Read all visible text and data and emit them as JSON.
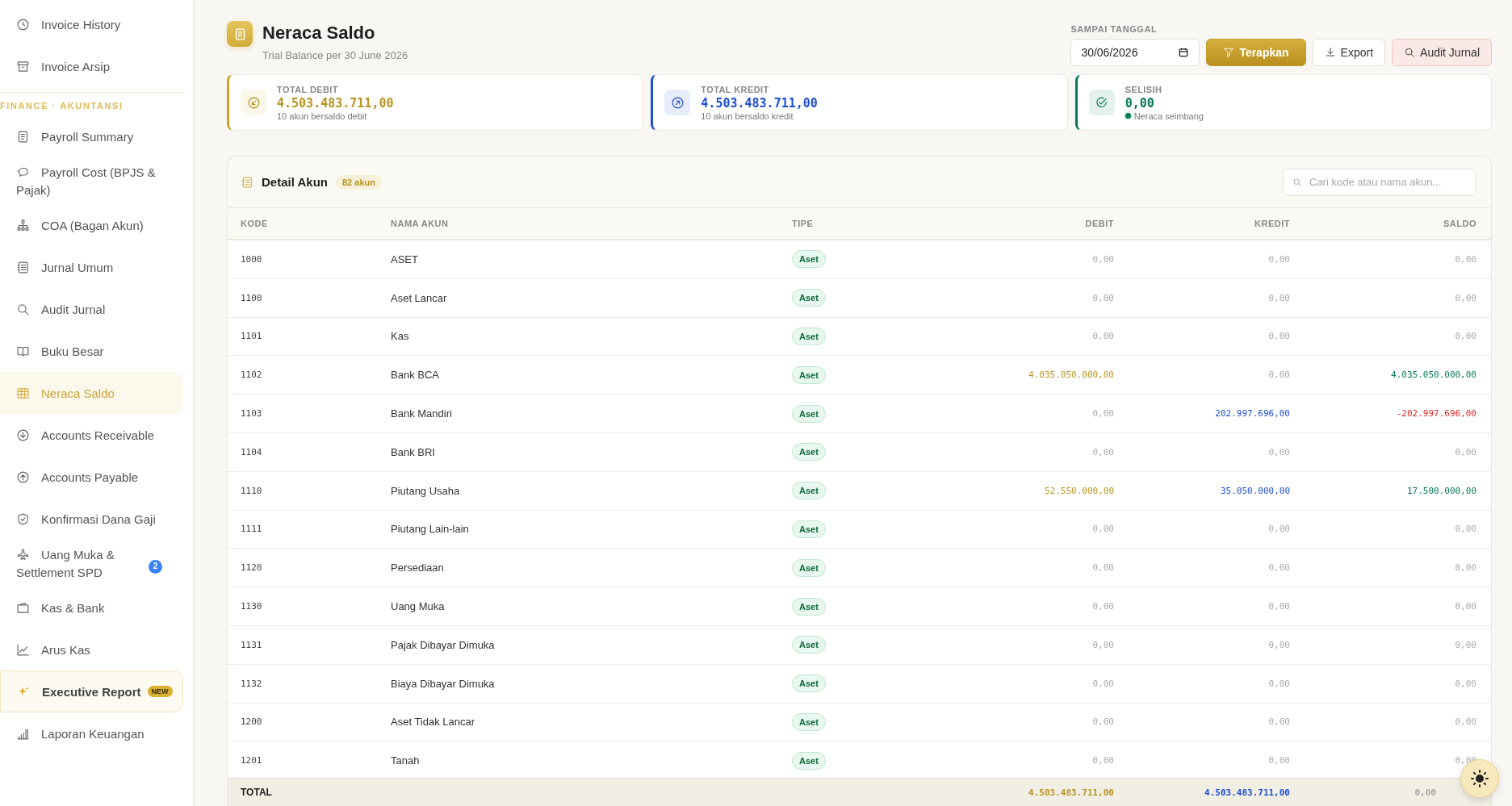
{
  "sidebar": {
    "items": [
      {
        "label": "Invoice History",
        "selected": false
      },
      {
        "label": "Invoice Arsip",
        "selected": false
      },
      {
        "kind": "section",
        "label": "FINANCE · AKUNTANSI"
      },
      {
        "label": "Payroll Summary",
        "selected": false
      },
      {
        "label": "Payroll Cost (BPJS & Pajak)",
        "selected": false
      },
      {
        "label": "COA (Bagan Akun)",
        "selected": false
      },
      {
        "label": "Jurnal Umum",
        "selected": false
      },
      {
        "label": "Audit Jurnal",
        "selected": false
      },
      {
        "label": "Buku Besar",
        "selected": false
      },
      {
        "label": "Neraca Saldo",
        "selected": true
      },
      {
        "label": "Accounts Receivable",
        "selected": false
      },
      {
        "label": "Accounts Payable",
        "selected": false
      },
      {
        "label": "Konfirmasi Dana Gaji",
        "selected": false
      },
      {
        "label": "Uang Muka & Settlement SPD",
        "selected": false,
        "badge": "2"
      },
      {
        "label": "Kas & Bank",
        "selected": false
      },
      {
        "label": "Arus Kas",
        "selected": false
      },
      {
        "kind": "featured",
        "label": "Executive Report",
        "selected": false,
        "badge": "NEW"
      },
      {
        "label": "Laporan Keuangan",
        "selected": false
      }
    ]
  },
  "header": {
    "title": "Neraca Saldo",
    "subtitle": "Trial Balance per 30 June 2026",
    "date_label": "SAMPAI TANGGAL",
    "date_value": "30/06/2026",
    "buttons": [
      {
        "label": "Terapkan",
        "kind": "primary"
      },
      {
        "label": "Export",
        "kind": "plain"
      },
      {
        "label": "Audit Jurnal",
        "kind": "danger"
      }
    ]
  },
  "summary": [
    {
      "label": "TOTAL DEBIT",
      "value": "4.503.483.711,00",
      "note": "10 akun bersaldo debit",
      "kind": "debit"
    },
    {
      "label": "TOTAL KREDIT",
      "value": "4.503.483.711,00",
      "note": "10 akun bersaldo kredit",
      "kind": "kredit"
    },
    {
      "label": "SELISIH",
      "value": "0,00",
      "note": "Neraca seimbang",
      "kind": "balance"
    }
  ],
  "table": {
    "title": "Detail Akun",
    "count": "82 akun",
    "search_placeholder": "Cari kode atau nama akun...",
    "columns": [
      "KODE",
      "NAMA AKUN",
      "TIPE",
      "DEBIT",
      "KREDIT",
      "SALDO"
    ],
    "rows": [
      {
        "code": "1000",
        "name": "ASET",
        "type": "Aset",
        "debit": {
          "text": "0,00",
          "color": "#a8a8a8"
        },
        "kredit": {
          "text": "0,00",
          "color": "#a8a8a8"
        },
        "saldo": {
          "text": "0,00",
          "color": "#a8a8a8"
        }
      },
      {
        "code": "1100",
        "name": "Aset Lancar",
        "type": "Aset",
        "debit": {
          "text": "0,00",
          "color": "#a8a8a8"
        },
        "kredit": {
          "text": "0,00",
          "color": "#a8a8a8"
        },
        "saldo": {
          "text": "0,00",
          "color": "#a8a8a8"
        }
      },
      {
        "code": "1101",
        "name": "Kas",
        "type": "Aset",
        "debit": {
          "text": "0,00",
          "color": "#a8a8a8"
        },
        "kredit": {
          "text": "0,00",
          "color": "#a8a8a8"
        },
        "saldo": {
          "text": "0,00",
          "color": "#a8a8a8"
        }
      },
      {
        "code": "1102",
        "name": "Bank BCA",
        "type": "Aset",
        "debit": {
          "text": "4.035.050.000,00",
          "color": "#b8941f"
        },
        "kredit": {
          "text": "0,00",
          "color": "#a8a8a8"
        },
        "saldo": {
          "text": "4.035.050.000,00",
          "color": "#047857"
        }
      },
      {
        "code": "1103",
        "name": "Bank Mandiri",
        "type": "Aset",
        "debit": {
          "text": "0,00",
          "color": "#a8a8a8"
        },
        "kredit": {
          "text": "202.997.696,00",
          "color": "#1d4ed8"
        },
        "saldo": {
          "text": "-202.997.696,00",
          "color": "#dc2626"
        }
      },
      {
        "code": "1104",
        "name": "Bank BRI",
        "type": "Aset",
        "debit": {
          "text": "0,00",
          "color": "#a8a8a8"
        },
        "kredit": {
          "text": "0,00",
          "color": "#a8a8a8"
        },
        "saldo": {
          "text": "0,00",
          "color": "#a8a8a8"
        }
      },
      {
        "code": "1110",
        "name": "Piutang Usaha",
        "type": "Aset",
        "debit": {
          "text": "52.550.000,00",
          "color": "#b8941f"
        },
        "kredit": {
          "text": "35.050.000,00",
          "color": "#1d4ed8"
        },
        "saldo": {
          "text": "17.500.000,00",
          "color": "#047857"
        }
      },
      {
        "code": "1111",
        "name": "Piutang Lain-lain",
        "type": "Aset",
        "debit": {
          "text": "0,00",
          "color": "#a8a8a8"
        },
        "kredit": {
          "text": "0,00",
          "color": "#a8a8a8"
        },
        "saldo": {
          "text": "0,00",
          "color": "#a8a8a8"
        }
      },
      {
        "code": "1120",
        "name": "Persediaan",
        "type": "Aset",
        "debit": {
          "text": "0,00",
          "color": "#a8a8a8"
        },
        "kredit": {
          "text": "0,00",
          "color": "#a8a8a8"
        },
        "saldo": {
          "text": "0,00",
          "color": "#a8a8a8"
        }
      },
      {
        "code": "1130",
        "name": "Uang Muka",
        "type": "Aset",
        "debit": {
          "text": "0,00",
          "color": "#a8a8a8"
        },
        "kredit": {
          "text": "0,00",
          "color": "#a8a8a8"
        },
        "saldo": {
          "text": "0,00",
          "color": "#a8a8a8"
        }
      },
      {
        "code": "1131",
        "name": "Pajak Dibayar Dimuka",
        "type": "Aset",
        "debit": {
          "text": "0,00",
          "color": "#a8a8a8"
        },
        "kredit": {
          "text": "0,00",
          "color": "#a8a8a8"
        },
        "saldo": {
          "text": "0,00",
          "color": "#a8a8a8"
        }
      },
      {
        "code": "1132",
        "name": "Biaya Dibayar Dimuka",
        "type": "Aset",
        "debit": {
          "text": "0,00",
          "color": "#a8a8a8"
        },
        "kredit": {
          "text": "0,00",
          "color": "#a8a8a8"
        },
        "saldo": {
          "text": "0,00",
          "color": "#a8a8a8"
        }
      },
      {
        "code": "1200",
        "name": "Aset Tidak Lancar",
        "type": "Aset",
        "debit": {
          "text": "0,00",
          "color": "#a8a8a8"
        },
        "kredit": {
          "text": "0,00",
          "color": "#a8a8a8"
        },
        "saldo": {
          "text": "0,00",
          "color": "#a8a8a8"
        }
      },
      {
        "code": "1201",
        "name": "Tanah",
        "type": "Aset",
        "debit": {
          "text": "0,00",
          "color": "#a8a8a8"
        },
        "kredit": {
          "text": "0,00",
          "color": "#a8a8a8"
        },
        "saldo": {
          "text": "0,00",
          "color": "#a8a8a8"
        }
      }
    ],
    "total": {
      "label": "TOTAL",
      "debit": "4.503.483.711,00",
      "kredit": "4.503.483.711,00",
      "saldo": "0,00"
    }
  }
}
